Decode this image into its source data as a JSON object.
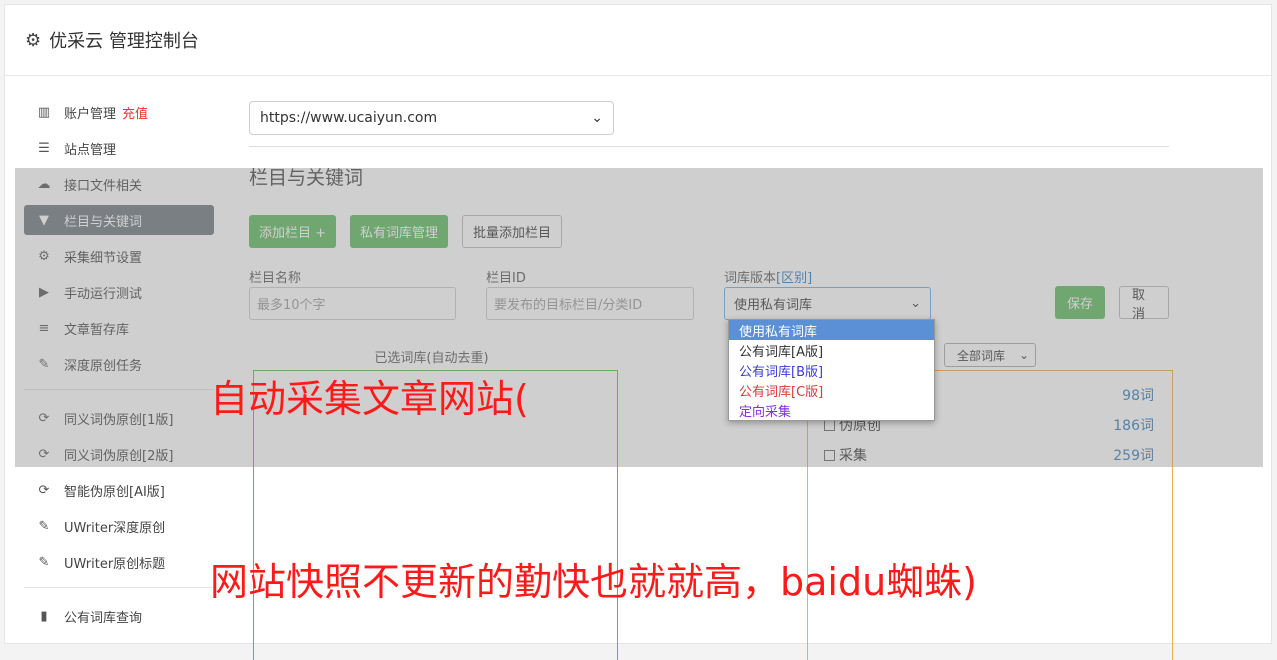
{
  "header": {
    "title": "优采云 管理控制台"
  },
  "sidebar": {
    "items": [
      {
        "label": "账户管理",
        "icon": "bar-chart-icon",
        "badge": "充值"
      },
      {
        "label": "站点管理",
        "icon": "server-icon"
      },
      {
        "label": "接口文件相关",
        "icon": "cloud-upload-icon"
      },
      {
        "label": "栏目与关键词",
        "icon": "filter-icon",
        "active": true
      },
      {
        "label": "采集细节设置",
        "icon": "cogs-icon"
      },
      {
        "label": "手动运行测试",
        "icon": "play-icon"
      },
      {
        "label": "文章暂存库",
        "icon": "database-icon"
      },
      {
        "label": "深度原创任务",
        "icon": "edit-icon"
      },
      {
        "label": "同义词伪原创[1版]",
        "icon": "refresh-icon"
      },
      {
        "label": "同义词伪原创[2版]",
        "icon": "refresh-icon"
      },
      {
        "label": "智能伪原创[AI版]",
        "icon": "refresh-icon"
      },
      {
        "label": "UWriter深度原创",
        "icon": "edit-icon"
      },
      {
        "label": "UWriter原创标题",
        "icon": "edit-icon"
      },
      {
        "label": "公有词库查询",
        "icon": "book-icon"
      }
    ]
  },
  "main": {
    "site_select": "https://www.ucaiyun.com",
    "section_title": "栏目与关键词",
    "buttons": {
      "add_column": "添加栏目 +",
      "private_lib": "私有词库管理",
      "batch_add": "批量添加栏目"
    },
    "form": {
      "name_label": "栏目名称",
      "name_placeholder": "最多10个字",
      "id_label": "栏目ID",
      "id_placeholder": "要发布的目标栏目/分类ID",
      "version_label": "词库版本",
      "version_link": "[区别]",
      "version_value": "使用私有词库"
    },
    "save": "保存",
    "cancel": "取消",
    "selected_label": "已选词库(自动去重)",
    "all_libs": "全部词库",
    "libs": [
      {
        "name": "",
        "count": "98词"
      },
      {
        "name": "伪原创",
        "count": "186词"
      },
      {
        "name": "采集",
        "count": "259词"
      }
    ],
    "dropdown_options": [
      {
        "label": "使用私有词库",
        "color": "#ffffff"
      },
      {
        "label": "公有词库[A版]",
        "color": "#333333"
      },
      {
        "label": "公有词库[B版]",
        "color": "#3b3bd6"
      },
      {
        "label": "公有词库[C版]",
        "color": "#d63b3b"
      },
      {
        "label": "定向采集",
        "color": "#8a2be2"
      }
    ]
  },
  "captions": {
    "line1": "自动采集文章网站(",
    "line2": "网站快照不更新的勤快也就就高，baidu蜘蛛)"
  }
}
